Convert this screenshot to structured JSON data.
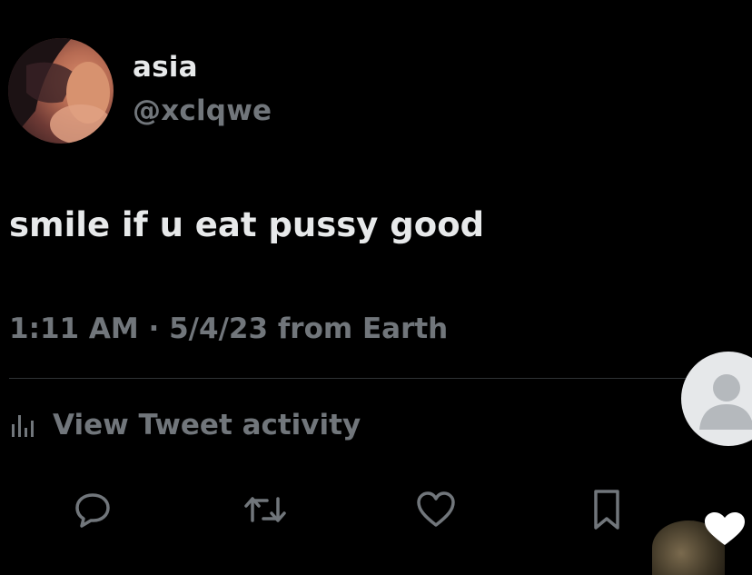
{
  "tweet": {
    "display_name": "asia",
    "handle": "@xclqwe",
    "text": "smile if u eat pussy good",
    "meta": "1:11 AM · 5/4/23 from Earth",
    "activity_label": "View Tweet activity"
  },
  "actions": [
    {
      "name": "reply",
      "icon": "reply-icon"
    },
    {
      "name": "retweet",
      "icon": "retweet-icon"
    },
    {
      "name": "like",
      "icon": "heart-icon"
    },
    {
      "name": "bookmark",
      "icon": "bookmark-icon"
    }
  ],
  "colors": {
    "background": "#000000",
    "primary_text": "#e7e9ea",
    "secondary_text": "#71767b",
    "divider": "#2f3336"
  }
}
